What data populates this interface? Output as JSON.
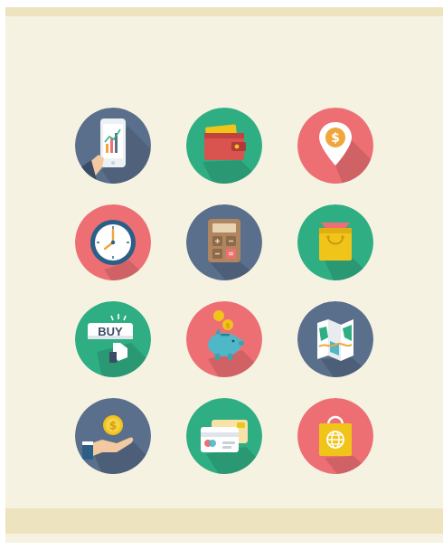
{
  "colors": {
    "background": "#f6f2e2",
    "band": "#ede3bf",
    "slate": "#5a6f8c",
    "green": "#2fae83",
    "coral": "#ed6f73"
  },
  "icons": [
    {
      "name": "smartphone-chart-icon",
      "bg": "#5a6f8c"
    },
    {
      "name": "wallet-icon",
      "bg": "#2fae83"
    },
    {
      "name": "location-dollar-pin-icon",
      "bg": "#ed6f73"
    },
    {
      "name": "clock-icon",
      "bg": "#ed6f73"
    },
    {
      "name": "calculator-icon",
      "bg": "#5a6f8c"
    },
    {
      "name": "shopping-bag-icon",
      "bg": "#2fae83"
    },
    {
      "name": "buy-button-icon",
      "bg": "#2fae83",
      "label": "BUY"
    },
    {
      "name": "piggy-bank-icon",
      "bg": "#ed6f73"
    },
    {
      "name": "folded-map-icon",
      "bg": "#5a6f8c"
    },
    {
      "name": "hand-coin-icon",
      "bg": "#5a6f8c"
    },
    {
      "name": "credit-cards-icon",
      "bg": "#2fae83"
    },
    {
      "name": "global-shopping-bag-icon",
      "bg": "#ed6f73"
    }
  ]
}
